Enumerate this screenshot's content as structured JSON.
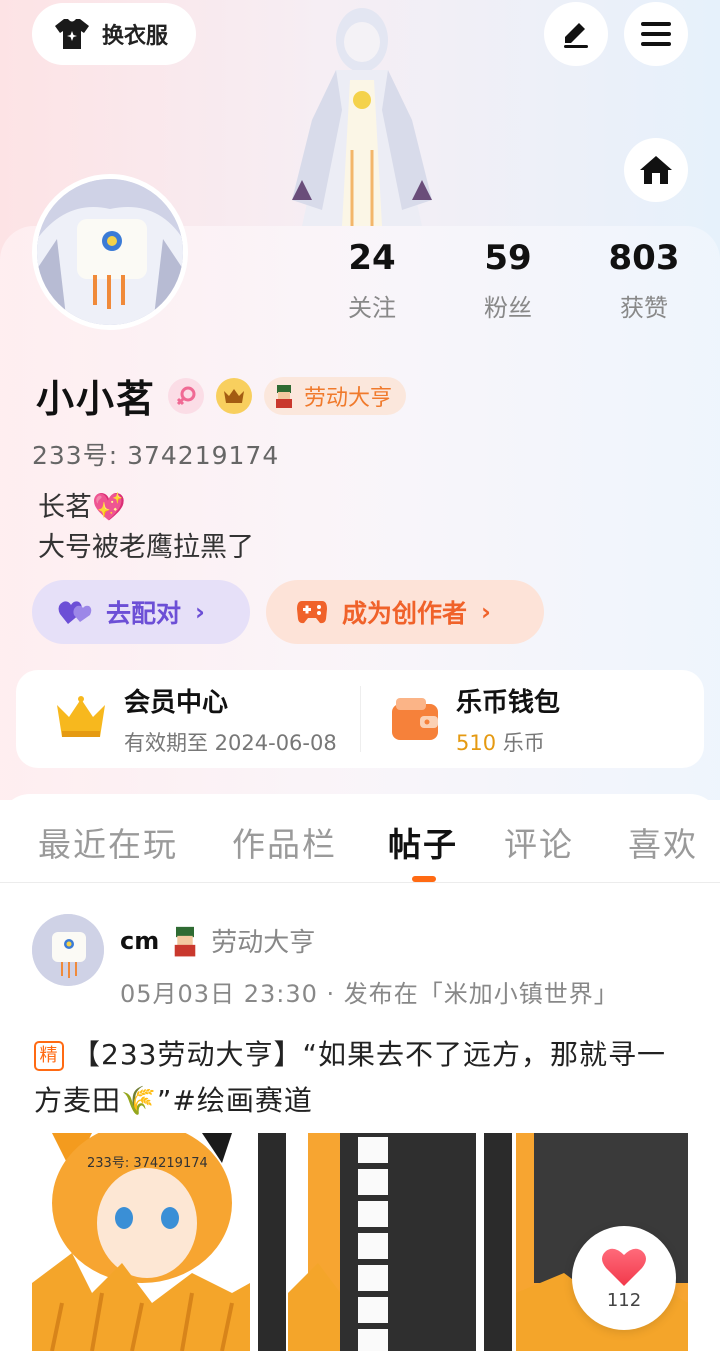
{
  "header": {
    "outfit_label": "换衣服"
  },
  "stats": [
    {
      "value": "24",
      "label": "关注"
    },
    {
      "value": "59",
      "label": "粉丝"
    },
    {
      "value": "803",
      "label": "获赞"
    }
  ],
  "profile": {
    "name": "小小茗",
    "tag": "劳动大亨",
    "uid": "233号: 374219174",
    "bio_line1": "长茗💖",
    "bio_line2": "大号被老鹰拉黑了"
  },
  "actions": {
    "match_label": "去配对",
    "creator_label": "成为创作者"
  },
  "wallet": {
    "vip_title": "会员中心",
    "vip_sub": "有效期至 2024-06-08",
    "coin_title": "乐币钱包",
    "coin_amount": "510",
    "coin_unit": "乐币"
  },
  "tabs": [
    {
      "label": "最近在玩",
      "active": false
    },
    {
      "label": "作品栏",
      "active": false
    },
    {
      "label": "帖子",
      "active": true
    },
    {
      "label": "评论",
      "active": false
    },
    {
      "label": "喜欢",
      "active": false
    }
  ],
  "post": {
    "author": "cm",
    "author_tag": "劳动大亨",
    "meta": "05月03日 23:30 · 发布在「米加小镇世界」",
    "badge": "精",
    "text": "【233劳动大亨】“如果去不了远方，那就寻一方麦田🌾”#绘画赛道",
    "image_watermark": "233号: 374219174",
    "like_count": "112"
  },
  "colors": {
    "accent": "#ff6a13",
    "match_bg": "#e6e0f8",
    "match_fg": "#6c4fd6",
    "creator_bg": "#fde3d8",
    "creator_fg": "#f0622a"
  }
}
